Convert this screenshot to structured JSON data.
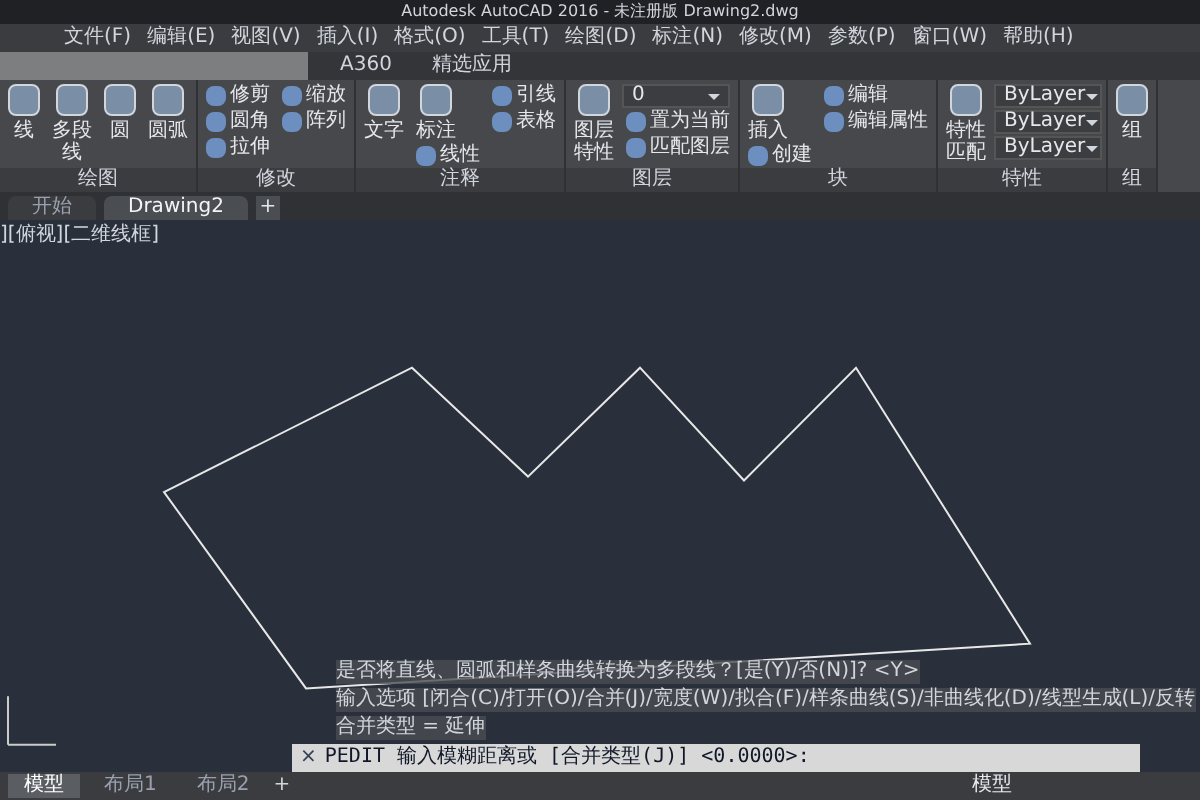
{
  "window": {
    "title": "Autodesk AutoCAD 2016 - 未注册版  Drawing2.dwg"
  },
  "menu": [
    "文件(F)",
    "编辑(E)",
    "视图(V)",
    "插入(I)",
    "格式(O)",
    "工具(T)",
    "绘图(D)",
    "标注(N)",
    "修改(M)",
    "参数(P)",
    "窗口(W)",
    "帮助(H)"
  ],
  "ribbon_tabs": [
    {
      "label": "A360",
      "selected": false
    },
    {
      "label": "精选应用",
      "selected": false
    }
  ],
  "panels": [
    {
      "title": "绘图",
      "tools": [
        {
          "label": "线",
          "kind": "big"
        },
        {
          "label": "多段线",
          "kind": "big"
        },
        {
          "label": "圆",
          "kind": "big"
        },
        {
          "label": "圆弧",
          "kind": "big"
        }
      ]
    },
    {
      "title": "修改",
      "tools": [
        {
          "label": "修剪",
          "kind": "small"
        },
        {
          "label": "圆角",
          "kind": "small"
        },
        {
          "label": "拉伸",
          "kind": "small"
        },
        {
          "label": "缩放",
          "kind": "small"
        },
        {
          "label": "阵列",
          "kind": "small"
        }
      ]
    },
    {
      "title": "注释",
      "tools": [
        {
          "label": "文字",
          "kind": "big"
        },
        {
          "label": "标注",
          "kind": "big"
        },
        {
          "label": "线性",
          "kind": "small"
        },
        {
          "label": "引线",
          "kind": "small"
        },
        {
          "label": "表格",
          "kind": "small"
        }
      ]
    },
    {
      "title": "图层",
      "tools": [
        {
          "label": "图层特性",
          "kind": "big"
        },
        {
          "label": "0",
          "kind": "dropdown"
        },
        {
          "label": "置为当前",
          "kind": "small"
        },
        {
          "label": "匹配图层",
          "kind": "small"
        }
      ]
    },
    {
      "title": "块",
      "tools": [
        {
          "label": "插入",
          "kind": "big"
        },
        {
          "label": "创建",
          "kind": "small"
        },
        {
          "label": "编辑",
          "kind": "small"
        },
        {
          "label": "编辑属性",
          "kind": "small"
        }
      ]
    },
    {
      "title": "特性",
      "tools": [
        {
          "label": "特性匹配",
          "kind": "big"
        },
        {
          "label": "ByLayer",
          "kind": "dropdown"
        },
        {
          "label": "ByLayer",
          "kind": "dropdown"
        },
        {
          "label": "ByLayer",
          "kind": "dropdown"
        }
      ]
    },
    {
      "title": "组",
      "tools": [
        {
          "label": "组",
          "kind": "big"
        }
      ]
    }
  ],
  "doc_tab_add": "+",
  "layout_tab_add": "+",
  "command_close": "×",
  "doc_tabs": [
    {
      "label": "开始",
      "selected": false
    },
    {
      "label": "Drawing2",
      "selected": true
    }
  ],
  "viewport": {
    "label": "][俯视][二维线框]"
  },
  "command": {
    "history": [
      "是否将直线、圆弧和样条曲线转换为多段线？[是(Y)/否(N)]? <Y>",
      "输入选项 [闭合(C)/打开(O)/合并(J)/宽度(W)/拟合(F)/样条曲线(S)/非曲线化(D)/线型生成(L)/反转",
      "合并类型 = 延伸"
    ],
    "prompt": "PEDIT 输入模糊距离或 [合并类型(J)] <0.0000>:"
  },
  "layout_tabs": [
    {
      "label": "模型",
      "selected": true
    },
    {
      "label": "布局1",
      "selected": false
    },
    {
      "label": "布局2",
      "selected": false
    }
  ],
  "status_bar": {
    "mode": "模型"
  }
}
